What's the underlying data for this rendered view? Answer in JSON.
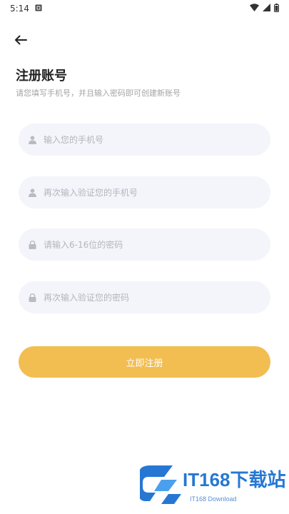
{
  "status_bar": {
    "time": "5:14"
  },
  "header": {
    "back_icon": "arrow-left-icon"
  },
  "page": {
    "title": "注册账号",
    "subtitle": "请您填写手机号，并且输入密码即可创建新账号"
  },
  "form": {
    "fields": [
      {
        "icon": "user-icon",
        "placeholder": "输入您的手机号"
      },
      {
        "icon": "user-icon",
        "placeholder": "再次输入验证您的手机号"
      },
      {
        "icon": "lock-icon",
        "placeholder": "请输入6-16位的密码"
      },
      {
        "icon": "lock-icon",
        "placeholder": "再次输入验证您的密码"
      }
    ],
    "submit_label": "立即注册"
  },
  "watermark": {
    "title": "IT168下载站",
    "subtitle": "IT168 Download"
  },
  "colors": {
    "accent": "#f2be52",
    "field_bg": "#f4f5fb",
    "watermark_blue": "#2677d3"
  }
}
